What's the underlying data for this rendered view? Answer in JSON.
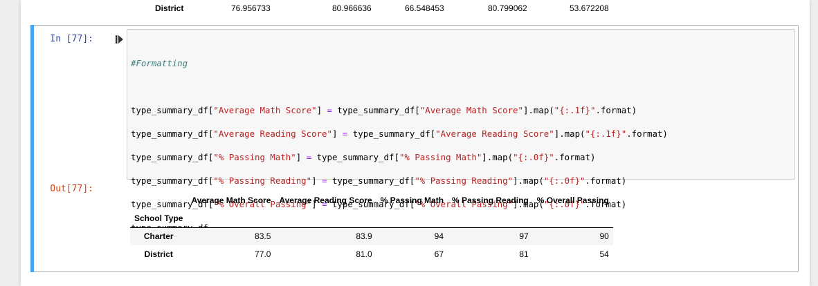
{
  "prev_output": {
    "row_label": "District",
    "values": [
      "76.956733",
      "80.966636",
      "66.548453",
      "80.799062",
      "53.672208"
    ]
  },
  "cell": {
    "in_prompt": "In [77]:",
    "out_prompt": "Out[77]:",
    "code": {
      "comment": "#Formatting",
      "lines": [
        {
          "df": "type_summary_df[",
          "key": "\"Average Math Score\"",
          "mid": "] ",
          "eq": "=",
          "rhs": " type_summary_df[",
          "key2": "\"Average Math Score\"",
          "tail": "].map(",
          "fmt": "\"{:.1f}\"",
          "end": ".format)"
        },
        {
          "df": "type_summary_df[",
          "key": "\"Average Reading Score\"",
          "mid": "] ",
          "eq": "=",
          "rhs": " type_summary_df[",
          "key2": "\"Average Reading Score\"",
          "tail": "].map(",
          "fmt": "\"{:.1f}\"",
          "end": ".format)"
        },
        {
          "df": "type_summary_df[",
          "key": "\"% Passing Math\"",
          "mid": "] ",
          "eq": "=",
          "rhs": " type_summary_df[",
          "key2": "\"% Passing Math\"",
          "tail": "].map(",
          "fmt": "\"{:.0f}\"",
          "end": ".format)"
        },
        {
          "df": "type_summary_df[",
          "key": "\"% Passing Reading\"",
          "mid": "] ",
          "eq": "=",
          "rhs": " type_summary_df[",
          "key2": "\"% Passing Reading\"",
          "tail": "].map(",
          "fmt": "\"{:.0f}\"",
          "end": ".format)"
        },
        {
          "df": "type_summary_df[",
          "key": "\"% Overall Passing\"",
          "mid": "] ",
          "eq": "=",
          "rhs": " type_summary_df[",
          "key2": "\"% Overall Passing\"",
          "tail": "].map(",
          "fmt": "\"{:.0f}\"",
          "end": ".format)"
        }
      ],
      "last": "type_summary_df"
    }
  },
  "table": {
    "columns": [
      "Average Math Score",
      "Average Reading Score",
      "% Passing Math",
      "% Passing Reading",
      "% Overall Passing"
    ],
    "index_name": "School Type",
    "rows": [
      {
        "label": "Charter",
        "values": [
          "83.5",
          "83.9",
          "94",
          "97",
          "90"
        ]
      },
      {
        "label": "District",
        "values": [
          "77.0",
          "81.0",
          "67",
          "81",
          "54"
        ]
      }
    ]
  },
  "icons": {
    "run": "run-cell-icon"
  },
  "colors": {
    "cell_selected_bar": "#42a5f5",
    "in_prompt": "#303f9f",
    "out_prompt": "#d84315",
    "comment": "#408080",
    "string": "#ba2121",
    "operator": "#aa22ff"
  }
}
